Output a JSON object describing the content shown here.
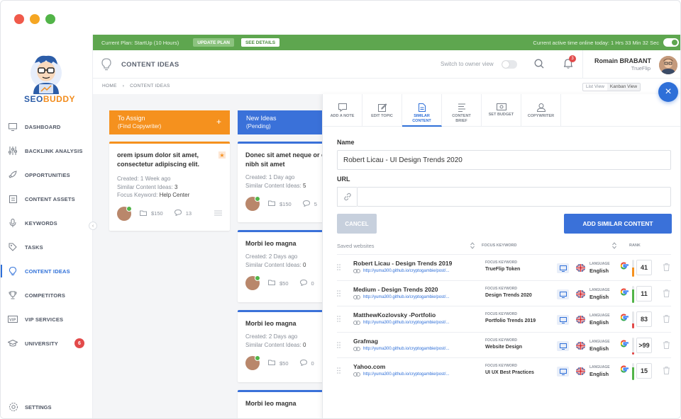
{
  "window": {
    "traffic_colors": [
      "#f05a4b",
      "#f5a623",
      "#52b448"
    ]
  },
  "brand": {
    "logo_text_a": "SEO",
    "logo_text_b": "BUDDY"
  },
  "sidebar": {
    "items": [
      {
        "label": "DASHBOARD",
        "icon": "monitor-icon"
      },
      {
        "label": "BACKLINK ANALYSIS",
        "icon": "sliders-icon"
      },
      {
        "label": "OPPORTUNITIES",
        "icon": "rocket-icon"
      },
      {
        "label": "CONTENT ASSETS",
        "icon": "clipboard-icon"
      },
      {
        "label": "KEYWORDS",
        "icon": "mic-icon"
      },
      {
        "label": "TASKS",
        "icon": "tag-icon"
      },
      {
        "label": "CONTENT IDEAS",
        "icon": "bulb-icon",
        "active": true
      },
      {
        "label": "COMPETITORS",
        "icon": "trophy-icon"
      },
      {
        "label": "VIP SERVICES",
        "icon": "vip-card-icon"
      },
      {
        "label": "UNIVERSITY",
        "icon": "graduation-cap-icon",
        "badge": "6"
      }
    ],
    "settings_label": "SETTINGS"
  },
  "planbar": {
    "plan_text": "Current Plan: StartUp (10 Hours)",
    "update_label": "UPDATE PLAN",
    "details_label": "SEE DETAILS",
    "active_time": "Current active time online today: 1 Hrs 33 Min 32 Sec"
  },
  "header": {
    "title": "CONTENT IDEAS",
    "switch_label": "Switch to owner view",
    "notif_count": "3",
    "user_name": "Romain BRABANT",
    "user_org": "TrueFlip"
  },
  "breadcrumb": {
    "home": "HOME",
    "sep": "›",
    "current": "CONTENT IDEAS"
  },
  "view_toggle": {
    "list": "List View",
    "kanban": "Kanban View"
  },
  "columns": {
    "assign": {
      "title": "To Assign",
      "subtitle": "(Find Copywriter)",
      "color": "#f5911e"
    },
    "new": {
      "title": "New Ideas",
      "subtitle": "(Pending)",
      "color": "#3a71d9"
    }
  },
  "cards": {
    "c1": {
      "title": "orem ipsum dolor sit amet, consectetur adipiscing elit.",
      "created": "Created: 1 Week ago",
      "similar_label": "Similar Content Ideas: ",
      "similar": "3",
      "focus_label": "Focus Keyword: ",
      "focus": "Help Center",
      "price": "$150",
      "comments": "13"
    },
    "c2": {
      "title": "Donec sit amet neque or ornare nibh sit amet",
      "created": "Created: 1 Day ago",
      "similar_label": "Similar Content Ideas: ",
      "similar": "5",
      "price": "$150",
      "comments": "5"
    },
    "c3": {
      "title": "Morbi leo magna",
      "created": "Created: 2 Days ago",
      "similar_label": "Similar Content Ideas: ",
      "similar": "0",
      "price": "$50",
      "comments": "0"
    },
    "c4": {
      "title": "Morbi leo magna",
      "created": "Created: 2 Days ago",
      "similar_label": "Similar Content Ideas: ",
      "similar": "0",
      "price": "$50",
      "comments": "0"
    },
    "c5": {
      "title": "Morbi leo magna"
    }
  },
  "panel": {
    "tabs": [
      {
        "label": "ADD A NOTE",
        "icon": "note-icon"
      },
      {
        "label": "EDIT TOPIC",
        "icon": "edit-icon"
      },
      {
        "label": "SIMILAR CONTENT",
        "icon": "document-icon",
        "active": true
      },
      {
        "label": "CONTENT BRIEF",
        "icon": "brief-icon"
      },
      {
        "label": "SET BUDGET",
        "icon": "money-icon"
      },
      {
        "label": "COPYWRITER",
        "icon": "person-icon"
      }
    ],
    "name_label": "Name",
    "name_value": "Robert Licau - UI Design Trends 2020",
    "url_label": "URL",
    "url_value": "",
    "cancel_label": "CANCEL",
    "add_label": "ADD SIMILAR CONTENT",
    "table_headers": {
      "saved": "Saved websites",
      "focus": "FOCUS KEYWORD",
      "rank": "RANK"
    },
    "rows": [
      {
        "name": "Robert Licau - Design Trends 2019",
        "url": "http://yuma300.github.io/cryptogambie/post/...",
        "fk_label": "FOCUS KEYWORD",
        "fk": "TrueFlip Token",
        "lang_label": "LANGUAGE",
        "lang": "English",
        "rank": "41",
        "bar_color": "#f5911e",
        "bar_level": 0.55
      },
      {
        "name": "Medium - Design Trends 2020",
        "url": "http://yuma300.github.io/cryptogambie/post/...",
        "fk_label": "FOCUS KEYWORD",
        "fk": "Design Trends 2020",
        "lang_label": "LANGUAGE",
        "lang": "English",
        "rank": "11",
        "bar_color": "#52b448",
        "bar_level": 0.8
      },
      {
        "name": "MatthewKozlovsky -Portfolio",
        "url": "http://yuma300.github.io/cryptogambie/post/...",
        "fk_label": "FOCUS KEYWORD",
        "fk": "Portfolio Trends 2019",
        "lang_label": "LANGUAGE",
        "lang": "English",
        "rank": "83",
        "bar_color": "#e24a4a",
        "bar_level": 0.3
      },
      {
        "name": "Grafmag",
        "url": "http://yuma300.github.io/cryptogambie/post/...",
        "fk_label": "FOCUS KEYWORD",
        "fk": "Website Design",
        "lang_label": "LANGUAGE",
        "lang": "English",
        "rank": ">99",
        "bar_color": "#e24a4a",
        "bar_level": 0.12
      },
      {
        "name": "Yahoo.com",
        "url": "http://yuma300.github.io/cryptogambie/post/...",
        "fk_label": "FOCUS KEYWORD",
        "fk": "UI UX Best Practices",
        "lang_label": "LANGUAGE",
        "lang": "English",
        "rank": "15",
        "bar_color": "#52b448",
        "bar_level": 0.75
      }
    ]
  }
}
